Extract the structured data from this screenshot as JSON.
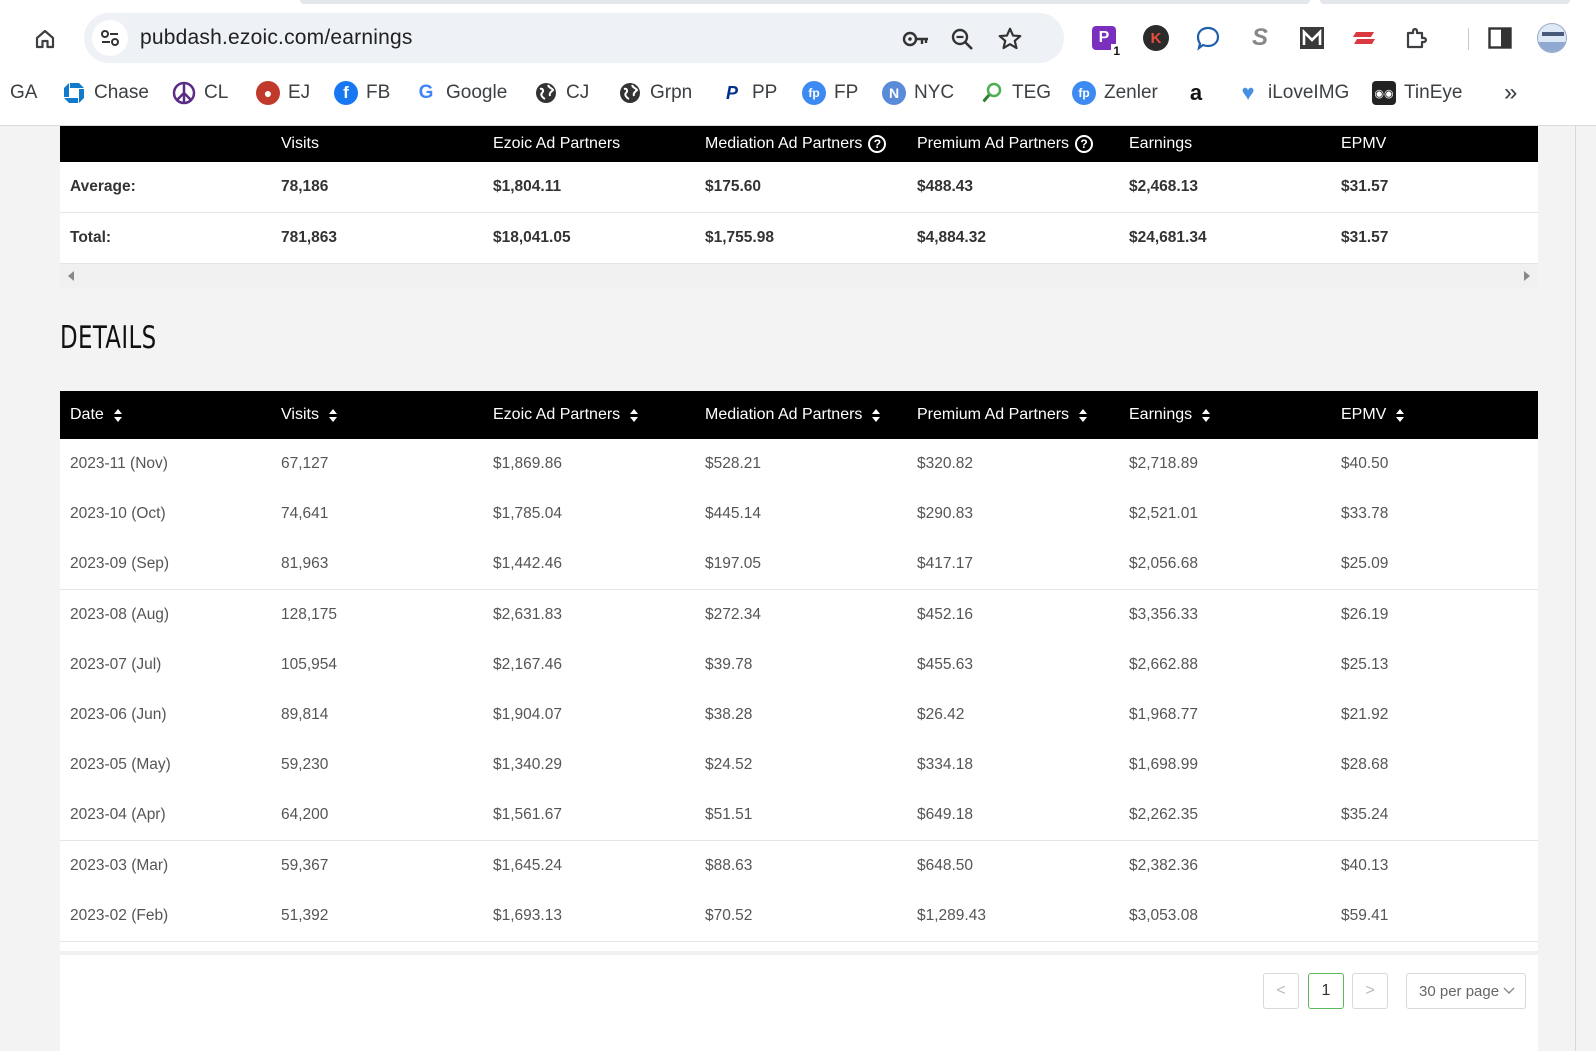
{
  "browser": {
    "url": "pubdash.ezoic.com/earnings",
    "extension_badge": "1",
    "bookmarks": [
      {
        "label": "GA",
        "icon": "ga-icon"
      },
      {
        "label": "Chase",
        "icon": "chase-icon",
        "color": "#117aca"
      },
      {
        "label": "CL",
        "icon": "peace-icon",
        "color": "#5b2c83"
      },
      {
        "label": "EJ",
        "icon": "ej-icon",
        "color": "#c0392b"
      },
      {
        "label": "FB",
        "icon": "facebook-icon",
        "color": "#1877f2"
      },
      {
        "label": "Google",
        "icon": "google-icon",
        "color": "#4285f4"
      },
      {
        "label": "CJ",
        "icon": "globe-icon",
        "color": "#333333"
      },
      {
        "label": "Grpn",
        "icon": "globe-icon",
        "color": "#333333"
      },
      {
        "label": "PP",
        "icon": "paypal-icon",
        "color": "#003087"
      },
      {
        "label": "FP",
        "icon": "fp-icon",
        "color": "#3d8bf2"
      },
      {
        "label": "NYC",
        "icon": "nyc-icon",
        "color": "#5a8bd8"
      },
      {
        "label": "TEG",
        "icon": "teg-icon",
        "color": "#4caf50"
      },
      {
        "label": "Zenler",
        "icon": "fp-icon",
        "color": "#3d8bf2"
      },
      {
        "label": "",
        "icon": "amazon-icon",
        "color": "#111111"
      },
      {
        "label": "iLoveIMG",
        "icon": "heart-icon",
        "color": "#4a90e2"
      },
      {
        "label": "TinEye",
        "icon": "tineye-icon",
        "color": "#222222"
      }
    ],
    "more_bookmarks": "»"
  },
  "summary": {
    "headers": [
      "",
      "Visits",
      "Ezoic Ad Partners",
      "Mediation Ad Partners",
      "Premium Ad Partners",
      "Earnings",
      "EPMV"
    ],
    "rows": [
      [
        "Average:",
        "78,186",
        "$1,804.11",
        "$175.60",
        "$488.43",
        "$2,468.13",
        "$31.57"
      ],
      [
        "Total:",
        "781,863",
        "$18,041.05",
        "$1,755.98",
        "$4,884.32",
        "$24,681.34",
        "$31.57"
      ]
    ]
  },
  "details": {
    "title": "DETAILS",
    "headers": [
      "Date",
      "Visits",
      "Ezoic Ad Partners",
      "Mediation Ad Partners",
      "Premium Ad Partners",
      "Earnings",
      "EPMV"
    ],
    "rows": [
      [
        "2023-11 (Nov)",
        "67,127",
        "$1,869.86",
        "$528.21",
        "$320.82",
        "$2,718.89",
        "$40.50"
      ],
      [
        "2023-10 (Oct)",
        "74,641",
        "$1,785.04",
        "$445.14",
        "$290.83",
        "$2,521.01",
        "$33.78"
      ],
      [
        "2023-09 (Sep)",
        "81,963",
        "$1,442.46",
        "$197.05",
        "$417.17",
        "$2,056.68",
        "$25.09"
      ],
      [
        "2023-08 (Aug)",
        "128,175",
        "$2,631.83",
        "$272.34",
        "$452.16",
        "$3,356.33",
        "$26.19"
      ],
      [
        "2023-07 (Jul)",
        "105,954",
        "$2,167.46",
        "$39.78",
        "$455.63",
        "$2,662.88",
        "$25.13"
      ],
      [
        "2023-06 (Jun)",
        "89,814",
        "$1,904.07",
        "$38.28",
        "$26.42",
        "$1,968.77",
        "$21.92"
      ],
      [
        "2023-05 (May)",
        "59,230",
        "$1,340.29",
        "$24.52",
        "$334.18",
        "$1,698.99",
        "$28.68"
      ],
      [
        "2023-04 (Apr)",
        "64,200",
        "$1,561.67",
        "$51.51",
        "$649.18",
        "$2,262.35",
        "$35.24"
      ],
      [
        "2023-03 (Mar)",
        "59,367",
        "$1,645.24",
        "$88.63",
        "$648.50",
        "$2,382.36",
        "$40.13"
      ],
      [
        "2023-02 (Feb)",
        "51,392",
        "$1,693.13",
        "$70.52",
        "$1,289.43",
        "$3,053.08",
        "$59.41"
      ]
    ]
  },
  "pagination": {
    "prev": "<",
    "current_page": "1",
    "next": ">",
    "per_page": "30 per page"
  }
}
